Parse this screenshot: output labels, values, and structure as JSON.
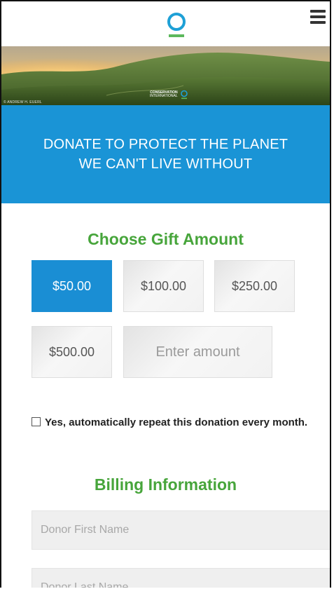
{
  "header": {
    "logo_icon": "conservation-international-ring-logo",
    "menu_icon": "hamburger-menu-icon"
  },
  "hero": {
    "credit": "© ANDREW H. EUERL",
    "brand_line1": "CONSERVATION",
    "brand_line2": "INTERNATIONAL"
  },
  "banner": {
    "line1": "DONATE TO PROTECT THE PLANET",
    "line2": "WE CAN'T LIVE WITHOUT",
    "bg_color": "#1a94d6"
  },
  "gift": {
    "title": "Choose Gift Amount",
    "amounts": [
      "$50.00",
      "$100.00",
      "$250.00",
      "$500.00"
    ],
    "selected": "$50.00",
    "custom_placeholder": "Enter amount"
  },
  "recurring": {
    "label": "Yes, automatically repeat this donation every month.",
    "checked": false
  },
  "billing": {
    "title": "Billing Information",
    "first_name_placeholder": "Donor First Name",
    "last_name_placeholder": "Donor Last Name"
  },
  "colors": {
    "accent_blue": "#1a8ed4",
    "title_green": "#47a53b",
    "logo_teal": "#1ea0d6",
    "logo_green": "#5cb85c"
  }
}
